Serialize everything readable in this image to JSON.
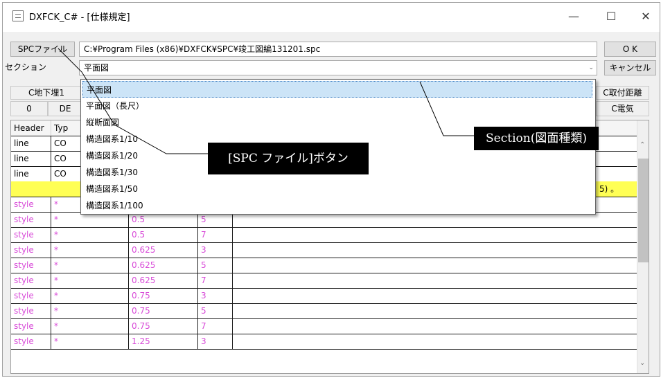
{
  "window": {
    "title": "DXFCK_C# - [仕様規定]",
    "minimize_glyph": "—",
    "maximize_glyph": "☐",
    "close_glyph": "✕"
  },
  "toolbar": {
    "spc_button": "SPCファイル",
    "spc_path": "C:¥Program Files (x86)¥DXFCK¥SPC¥竣工図編131201.spc",
    "ok_button": "O K",
    "section_label": "セクション",
    "section_value": "平面図",
    "cancel_button": "キャンセル"
  },
  "tabs_row1": [
    "C地下埋1",
    "C取付距離"
  ],
  "tabs_row2": [
    "0",
    "DE",
    "C電気"
  ],
  "grid": {
    "headers": [
      "Header",
      "Typ"
    ],
    "line_rows": [
      {
        "header": "line",
        "type": "CO"
      },
      {
        "header": "line",
        "type": "CO"
      },
      {
        "header": "line",
        "type": "CO"
      }
    ],
    "yellow_text": "5) 。",
    "style_rows": [
      {
        "header": "style",
        "type": "*",
        "value": "",
        "num": ""
      },
      {
        "header": "style",
        "type": "*",
        "value": "0.5",
        "num": "5"
      },
      {
        "header": "style",
        "type": "*",
        "value": "0.5",
        "num": "7"
      },
      {
        "header": "style",
        "type": "*",
        "value": "0.625",
        "num": "3"
      },
      {
        "header": "style",
        "type": "*",
        "value": "0.625",
        "num": "5"
      },
      {
        "header": "style",
        "type": "*",
        "value": "0.625",
        "num": "7"
      },
      {
        "header": "style",
        "type": "*",
        "value": "0.75",
        "num": "3"
      },
      {
        "header": "style",
        "type": "*",
        "value": "0.75",
        "num": "5"
      },
      {
        "header": "style",
        "type": "*",
        "value": "0.75",
        "num": "7"
      },
      {
        "header": "style",
        "type": "*",
        "value": "1.25",
        "num": "3"
      }
    ]
  },
  "dropdown": {
    "items": [
      "平面図",
      "平面図（長尺）",
      "縦断面図",
      "構造図系1/10",
      "構造図系1/20",
      "構造図系1/30",
      "構造図系1/50",
      "構造図系1/100"
    ],
    "selected_index": 0
  },
  "annotations": {
    "section_callout": "Section(図面種類)",
    "spc_callout": "[SPC ファイル]ボタン"
  },
  "colors": {
    "style_text": "#d84bd8",
    "highlight_row": "#ffff55",
    "selected_item": "#cce4f7"
  }
}
